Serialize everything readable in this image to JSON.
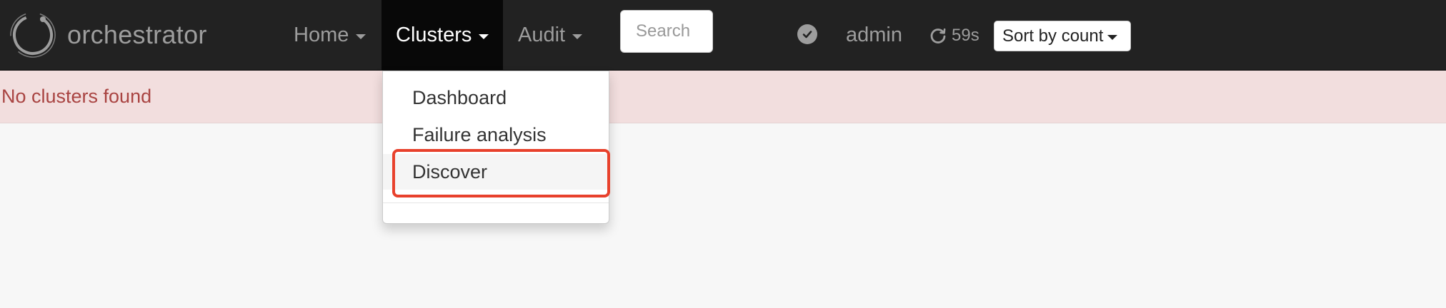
{
  "brand": {
    "name": "orchestrator",
    "logo_icon": "orchestrator-ring-logo"
  },
  "nav": {
    "home": "Home",
    "clusters": "Clusters",
    "audit": "Audit"
  },
  "search": {
    "placeholder": "Search",
    "value": ""
  },
  "status_icon": "check-circle-icon",
  "user": "admin",
  "refresh": {
    "icon": "refresh-icon",
    "countdown": "59s"
  },
  "sort": {
    "selected": "Sort by count"
  },
  "alert": {
    "message": "No clusters found"
  },
  "clusters_menu": {
    "items": [
      {
        "label": "Dashboard"
      },
      {
        "label": "Failure analysis"
      },
      {
        "label": "Discover"
      }
    ]
  },
  "colors": {
    "navbar": "#222222",
    "nav_active": "#080808",
    "alert_bg": "#f2dede",
    "alert_text": "#a94442",
    "highlight": "#e8412c"
  }
}
